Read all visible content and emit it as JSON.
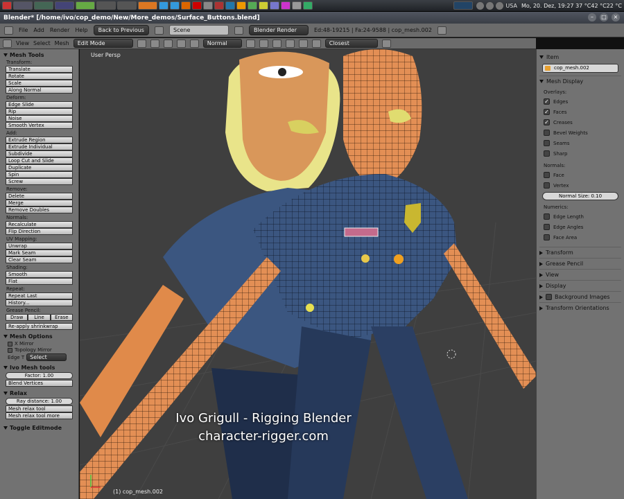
{
  "os": {
    "clock": "Mo, 20. Dez, 19:27 37 °C42 °C22 °C",
    "layout": "USA"
  },
  "window": {
    "title": "Blender* [/home/ivo/cop_demo/New/More_demos/Surface_Buttons.blend]"
  },
  "info_header": {
    "menus": [
      "File",
      "Add",
      "Render",
      "Help"
    ],
    "back_button": "Back to Previous",
    "scene": "Scene",
    "engine": "Blender Render",
    "stats": "Ed:48-19215 | Fa:24-9588 | cop_mesh.002"
  },
  "view_header": {
    "menus": [
      "View",
      "Select",
      "Mesh"
    ],
    "mode": "Edit Mode",
    "orientation": "Normal",
    "snap": "Closest"
  },
  "toolshelf": {
    "title": "Mesh Tools",
    "transform_label": "Transform:",
    "transform": [
      "Translate",
      "Rotate",
      "Scale",
      "Along Normal"
    ],
    "deform_label": "Deform:",
    "deform": [
      "Edge Slide",
      "Rip",
      "Noise",
      "Smooth Vertex"
    ],
    "add_label": "Add:",
    "add": [
      "Extrude Region",
      "Extrude Individual",
      "Subdivide",
      "Loop Cut and Slide",
      "Duplicate",
      "Spin",
      "Screw"
    ],
    "remove_label": "Remove:",
    "remove": [
      "Delete",
      "Merge",
      "Remove Doubles"
    ],
    "normals_label": "Normals:",
    "normals": [
      "Recalculate",
      "Flip Direction"
    ],
    "uv_label": "UV Mapping:",
    "uv": [
      "Unwrap",
      "Mark Seam",
      "Clear Seam"
    ],
    "shading_label": "Shading:",
    "shading": [
      "Smooth",
      "Flat"
    ],
    "repeat_label": "Repeat:",
    "repeat": [
      "Repeat Last",
      "History..."
    ],
    "grease_label": "Grease Pencil:",
    "grease": [
      "Draw",
      "Line",
      "Erase"
    ],
    "reapply": "Re-apply shrinkwrap",
    "mesh_options_title": "Mesh Options",
    "x_mirror": "X Mirror",
    "topology_mirror": "Topology Mirror",
    "edge_t": "Edge T",
    "edge_select": "Select",
    "ivo_title": "Ivo Mesh tools",
    "factor": "Factor: 1.00",
    "blend_vertices": "Blend Vertices",
    "relax_title": "Relax",
    "ray_distance": "Ray distance: 1.00",
    "relax_tool": "Mesh relax tool",
    "relax_tool_more": "Mesh relax tool more",
    "toggle_editmode": "Toggle Editmode"
  },
  "viewport": {
    "perspective": "User Persp",
    "object": "(1) cop_mesh.002",
    "watermark_line1": "Ivo Grigull - Rigging Blender",
    "watermark_line2": "character-rigger.com"
  },
  "properties": {
    "item_title": "Item",
    "item_name": "cop_mesh.002",
    "mesh_display_title": "Mesh Display",
    "overlays_label": "Overlays:",
    "overlays": [
      {
        "label": "Edges",
        "checked": true
      },
      {
        "label": "Faces",
        "checked": true
      },
      {
        "label": "Creases",
        "checked": true
      },
      {
        "label": "Bevel Weights",
        "checked": false
      },
      {
        "label": "Seams",
        "checked": false
      },
      {
        "label": "Sharp",
        "checked": false
      }
    ],
    "normals_label": "Normals:",
    "normals": [
      "Face",
      "Vertex"
    ],
    "normal_size": "Normal Size: 0.10",
    "numerics_label": "Numerics:",
    "numerics": [
      "Edge Length",
      "Edge Angles",
      "Face Area"
    ],
    "collapsed": [
      "Transform",
      "Grease Pencil",
      "View",
      "Display",
      "Background Images",
      "Transform Orientations"
    ]
  }
}
